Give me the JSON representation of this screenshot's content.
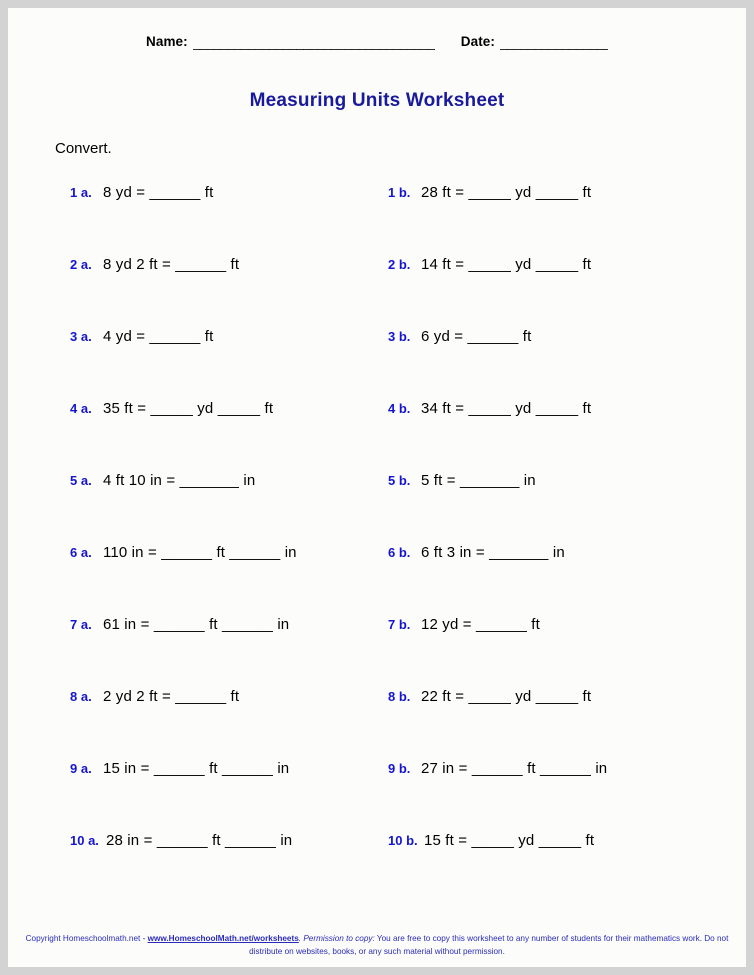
{
  "header": {
    "name_label": "Name:",
    "name_rule": "________________________________________",
    "date_label": "Date:",
    "date_rule": "_________________"
  },
  "title": "Measuring Units Worksheet",
  "instruction": "Convert.",
  "problems": [
    {
      "a": {
        "number": "1 a.",
        "text": "8 yd  =  ______ ft"
      },
      "b": {
        "number": "1 b.",
        "text": "28 ft  =  _____ yd _____ ft"
      }
    },
    {
      "a": {
        "number": "2 a.",
        "text": "8 yd 2 ft  =  ______ ft"
      },
      "b": {
        "number": "2 b.",
        "text": "14 ft  =  _____ yd _____ ft"
      }
    },
    {
      "a": {
        "number": "3 a.",
        "text": "4 yd  =  ______ ft"
      },
      "b": {
        "number": "3 b.",
        "text": "6 yd  =  ______ ft"
      }
    },
    {
      "a": {
        "number": "4 a.",
        "text": "35 ft  =  _____ yd _____ ft"
      },
      "b": {
        "number": "4 b.",
        "text": "34 ft  =  _____ yd _____ ft"
      }
    },
    {
      "a": {
        "number": "5 a.",
        "text": "4 ft 10 in  =  _______ in"
      },
      "b": {
        "number": "5 b.",
        "text": "5 ft  =  _______ in"
      }
    },
    {
      "a": {
        "number": "6 a.",
        "text": "110 in  =  ______ ft ______ in"
      },
      "b": {
        "number": "6 b.",
        "text": "6 ft 3 in  =  _______ in"
      }
    },
    {
      "a": {
        "number": "7 a.",
        "text": "61 in  =  ______ ft ______ in"
      },
      "b": {
        "number": "7 b.",
        "text": "12 yd  =  ______ ft"
      }
    },
    {
      "a": {
        "number": "8 a.",
        "text": "2 yd 2 ft  =  ______ ft"
      },
      "b": {
        "number": "8 b.",
        "text": "22 ft  =  _____ yd _____ ft"
      }
    },
    {
      "a": {
        "number": "9 a.",
        "text": "15 in  =  ______ ft ______ in"
      },
      "b": {
        "number": "9 b.",
        "text": "27 in  =  ______ ft ______ in"
      }
    },
    {
      "a": {
        "number": "10 a.",
        "text": "28 in  =  ______ ft ______ in"
      },
      "b": {
        "number": "10 b.",
        "text": "15 ft  =  _____ yd _____ ft"
      }
    }
  ],
  "footer": {
    "copyright_prefix": "Copyright Homeschoolmath.net - ",
    "url": "www.HomeschoolMath.net/worksheets",
    "permission_label": ". Permission to copy:",
    "permission_text": " You are free to copy this worksheet to any number of students for their mathematics work. Do not distribute on websites, books, or any such material without permission."
  },
  "colors": {
    "title_blue": "#1a1a9c",
    "number_blue": "#1414d2",
    "footer_blue": "#2b2bbb",
    "page_background": "#fcfdfa",
    "outer_border": "#d3d3d3"
  }
}
